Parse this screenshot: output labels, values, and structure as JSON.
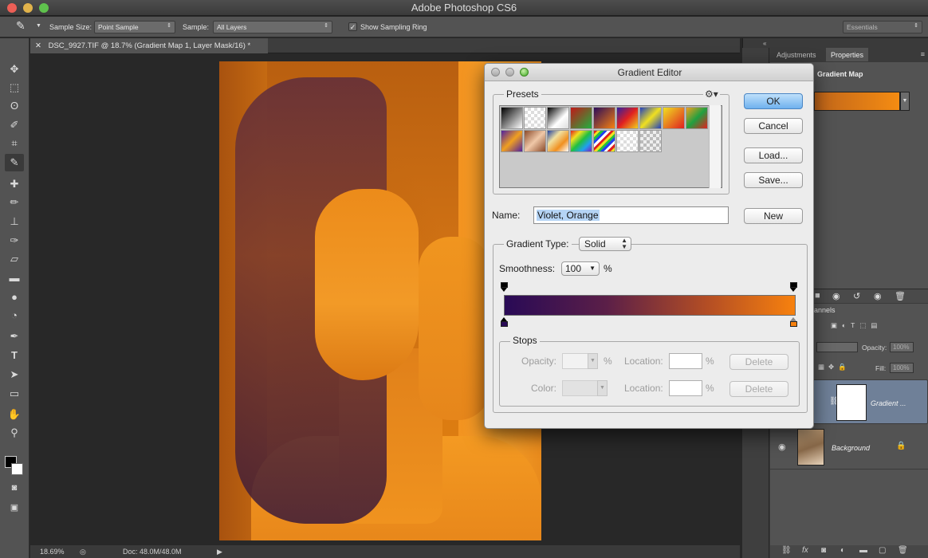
{
  "app": {
    "title": "Adobe Photoshop CS6"
  },
  "options_bar": {
    "sample_size_label": "Sample Size:",
    "sample_size_value": "Point Sample",
    "sample_label": "Sample:",
    "sample_value": "All Layers",
    "show_ring_label": "Show Sampling Ring",
    "show_ring_checked": true,
    "workspace": "Essentials"
  },
  "document": {
    "tab_title": "DSC_9927.TIF @ 18.7% (Gradient Map 1, Layer Mask/16) *",
    "zoom": "18.69%",
    "doc_size": "Doc: 48.0M/48.0M"
  },
  "tools": [
    "move-tool",
    "marquee-tool",
    "lasso-tool",
    "quick-select-tool",
    "crop-tool",
    "eyedropper-tool",
    "healing-tool",
    "brush-tool",
    "stamp-tool",
    "history-brush-tool",
    "eraser-tool",
    "gradient-tool",
    "blur-tool",
    "dodge-tool",
    "pen-tool",
    "type-tool",
    "path-select-tool",
    "shape-tool",
    "hand-tool",
    "zoom-tool"
  ],
  "properties_panel": {
    "tabs": [
      "Adjustments",
      "Properties"
    ],
    "active_tab": "Properties",
    "adjustment_name": "Gradient Map"
  },
  "layers_panel": {
    "channels_tab": "hannels",
    "opacity_label": "Opacity:",
    "opacity_value": "100%",
    "fill_label": "Fill:",
    "fill_value": "100%",
    "layers": [
      {
        "name": "Gradient ...",
        "selected": true
      },
      {
        "name": "Background",
        "selected": false
      }
    ]
  },
  "gradient_editor": {
    "title": "Gradient Editor",
    "presets_label": "Presets",
    "buttons": {
      "ok": "OK",
      "cancel": "Cancel",
      "load": "Load...",
      "save": "Save...",
      "new": "New",
      "delete": "Delete"
    },
    "name_label": "Name:",
    "name_value": "Violet, Orange",
    "gradient_type_label": "Gradient Type:",
    "gradient_type_value": "Solid",
    "smoothness_label": "Smoothness:",
    "smoothness_value": "100",
    "percent": "%",
    "stops_label": "Stops",
    "opacity_label": "Opacity:",
    "color_label": "Color:",
    "location_label": "Location:",
    "gradient_colors": [
      "#290a56",
      "#f7810e"
    ]
  }
}
